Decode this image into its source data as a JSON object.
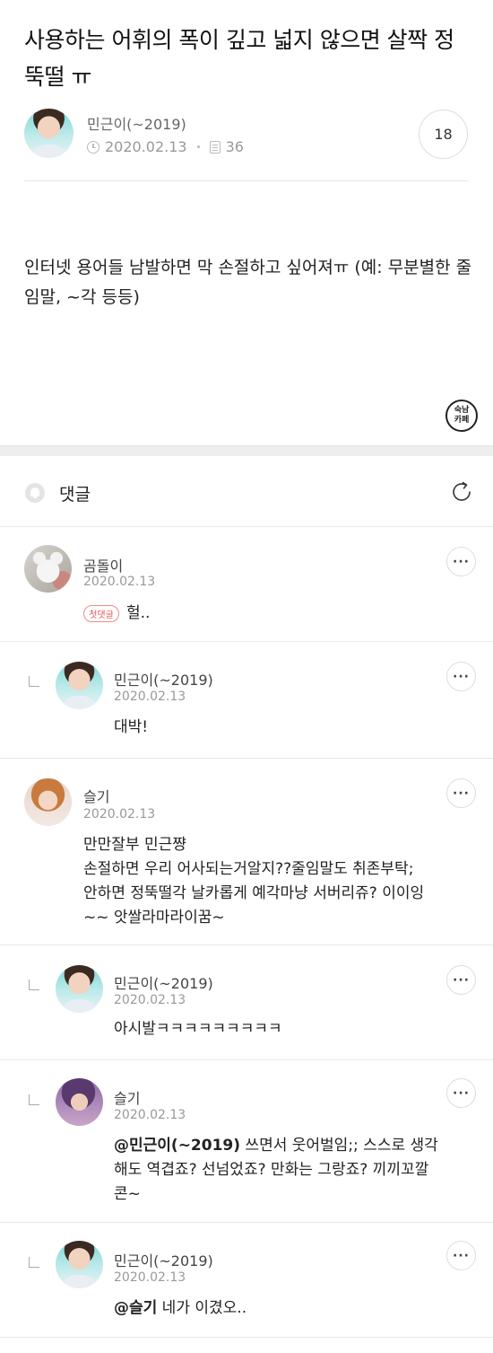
{
  "post": {
    "title": "사용하는 어휘의 폭이 깊고 넓지 않으면 살짝 정뚝떨 ㅠ",
    "author": "민근이(~2019)",
    "date": "2020.02.13",
    "views": "36",
    "comment_count": "18",
    "body": "인터넷 용어들 남발하면 막 손절하고 싶어져ㅠ (예: 무분별한 줄임말, ~각 등등)",
    "cafe_badge": [
      "숙남",
      "카페"
    ]
  },
  "comments_section": {
    "title": "댓글",
    "more_label": "···",
    "first_comment_badge": "첫댓글"
  },
  "comments": [
    {
      "author": "곰돌이",
      "date": "2020.02.13",
      "text": "헐.."
    },
    {
      "author": "민근이(~2019)",
      "date": "2020.02.13",
      "text": "대박!"
    },
    {
      "author": "슬기",
      "date": "2020.02.13",
      "lines": [
        "만만잘부 민근쨩",
        "손절하면 우리 어사되는거알지??줄임말도 취존부탁;",
        "안하면 정뚝떨각 날카롭게 예각마냥 서버리쥬? 이이잉",
        "~~ 앗쌀라마라이꿈~"
      ]
    },
    {
      "author": "민근이(~2019)",
      "date": "2020.02.13",
      "text": "아시발ㅋㅋㅋㅋㅋㅋㅋㅋㅋ"
    },
    {
      "author": "슬기",
      "date": "2020.02.13",
      "mention": "@민근이(~2019)",
      "lines": [
        " 쓰면서 웃어벌임;; 스스로 생각",
        "해도 역겹죠? 선넘었죠? 만화는 그랑죠? 끼끼꼬깔",
        "콘~"
      ]
    },
    {
      "author": "민근이(~2019)",
      "date": "2020.02.13",
      "mention": "@슬기",
      "text": " 네가 이겼오.."
    }
  ]
}
